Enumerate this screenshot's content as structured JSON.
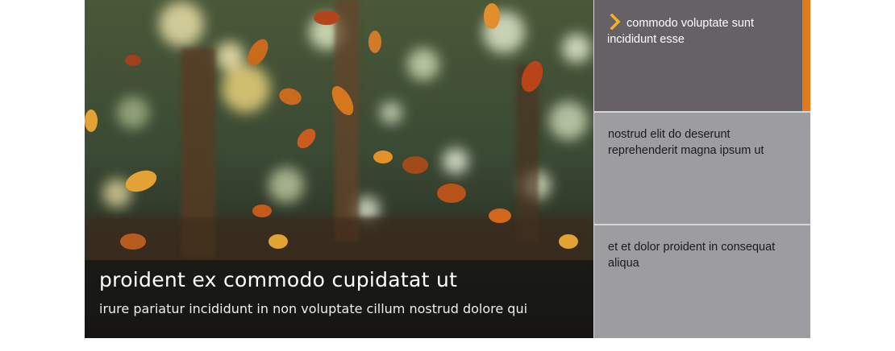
{
  "hero": {
    "title": "proident ex commodo cupidatat ut",
    "subtitle": "irure pariatur incididunt in non voluptate cillum nostrud dolore qui"
  },
  "tabs": [
    {
      "label": "commodo voluptate sunt incididunt esse",
      "active": true
    },
    {
      "label": "nostrud elit do deserunt reprehenderit magna ipsum ut",
      "active": false
    },
    {
      "label": "et et dolor proident in consequat aliqua",
      "active": false
    }
  ],
  "colors": {
    "accent": "#e27a1c",
    "chevron": "#f5b21f",
    "active_tab": "#656166",
    "inactive_tab": "#9d9ca1"
  },
  "icons": {
    "active_indicator": "chevron-right-icon"
  }
}
